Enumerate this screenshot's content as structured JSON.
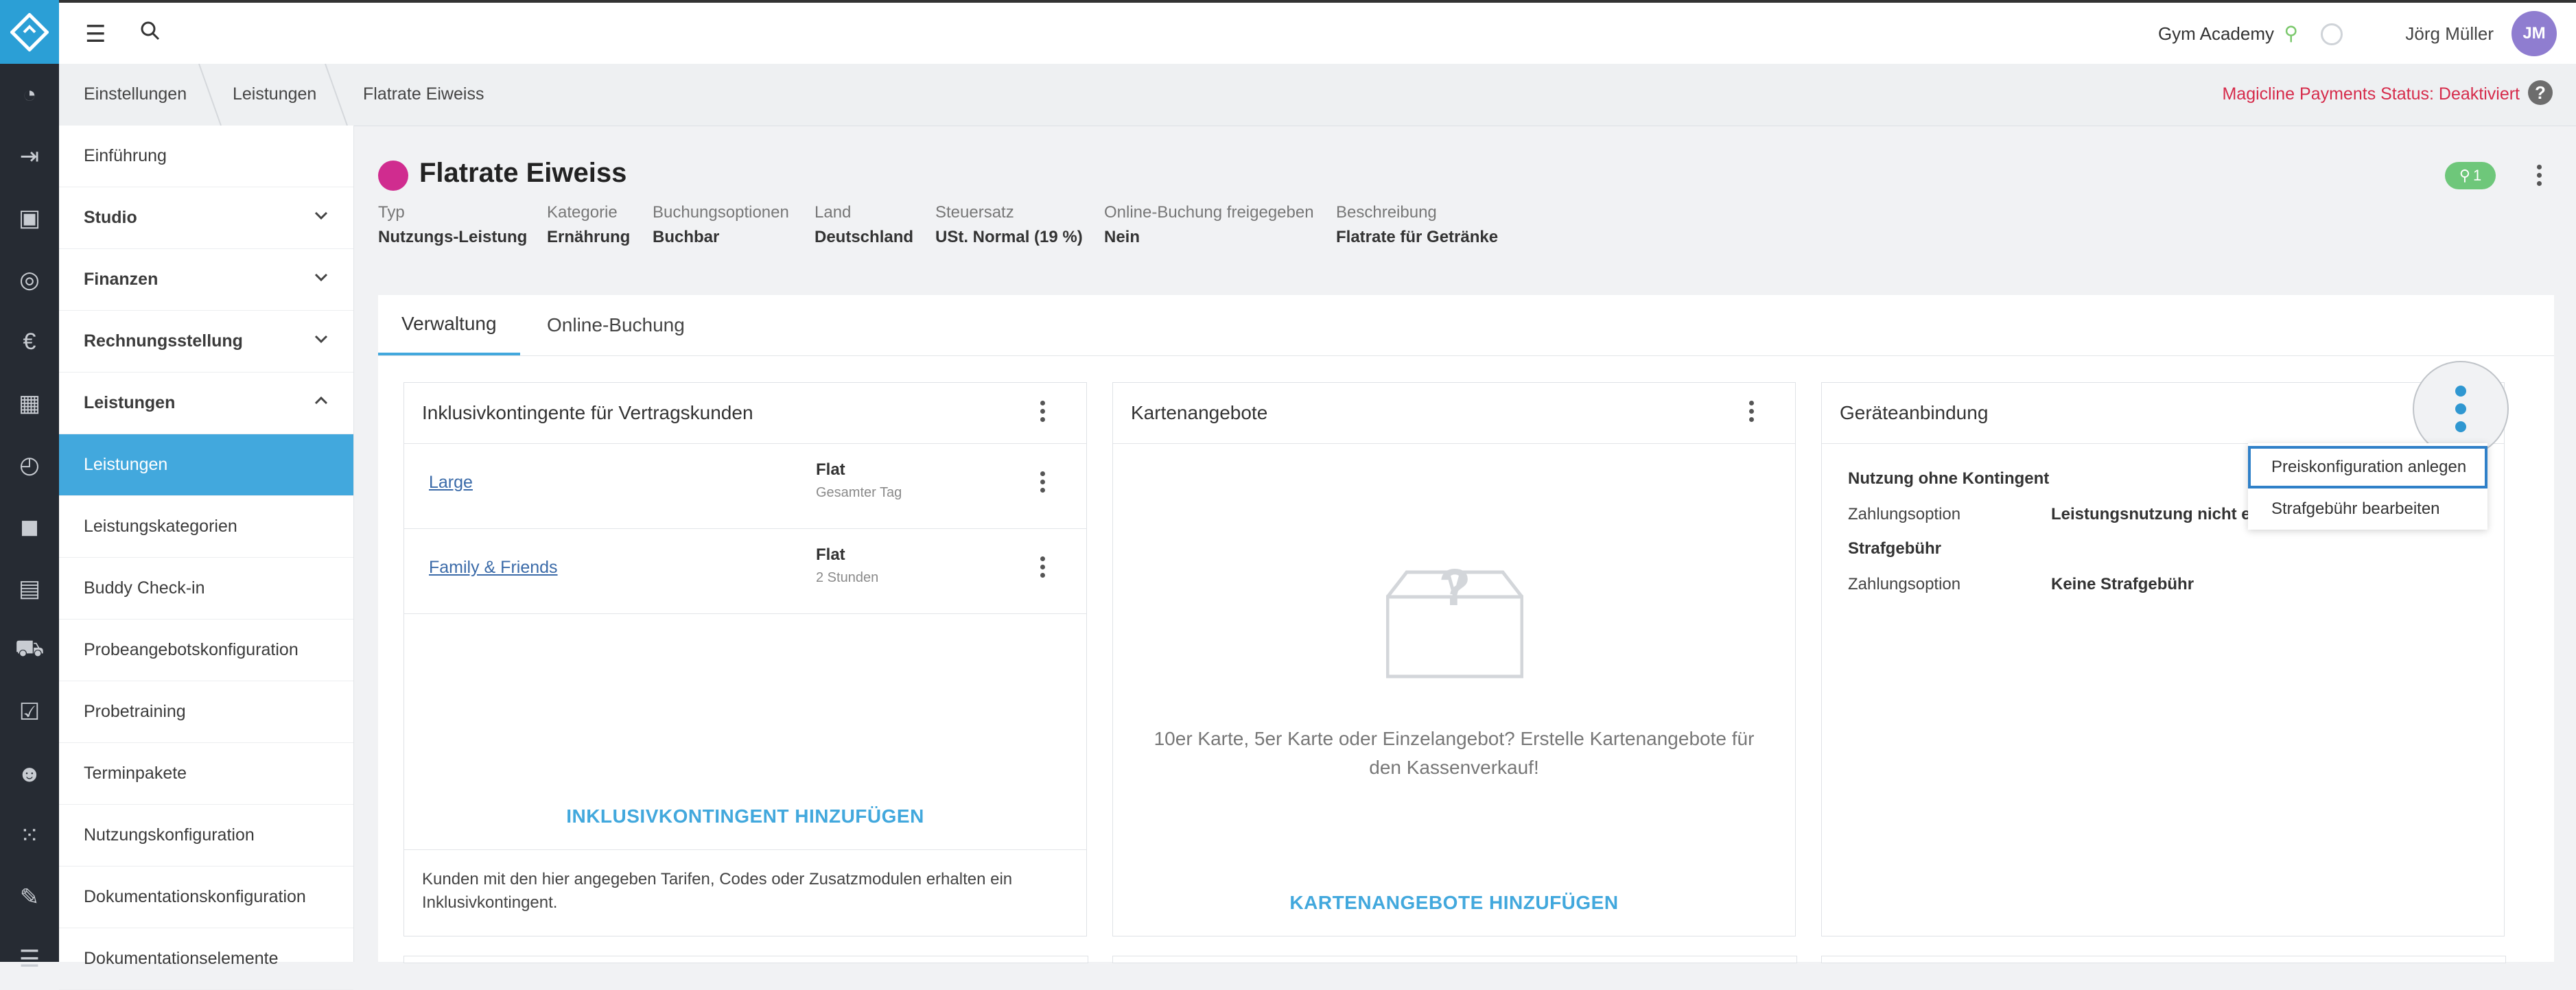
{
  "topbar": {
    "studio": "Gym Academy",
    "user_name": "Jörg Müller",
    "avatar_initials": "JM"
  },
  "breadcrumb": [
    "Einstellungen",
    "Leistungen",
    "Flatrate Eiweiss"
  ],
  "payments_status": "Magicline Payments Status: Deaktiviert",
  "help_label": "?",
  "sidebar": {
    "items": [
      {
        "label": "Einführung"
      },
      {
        "label": "Studio"
      },
      {
        "label": "Finanzen"
      },
      {
        "label": "Rechnungsstellung"
      },
      {
        "label": "Leistungen"
      },
      {
        "label": "Leistungen"
      },
      {
        "label": "Leistungskategorien"
      },
      {
        "label": "Buddy Check-in"
      },
      {
        "label": "Probeangebotskonfiguration"
      },
      {
        "label": "Probetraining"
      },
      {
        "label": "Terminpakete"
      },
      {
        "label": "Nutzungskonfiguration"
      },
      {
        "label": "Dokumentationskonfiguration"
      },
      {
        "label": "Dokumentationselemente"
      }
    ]
  },
  "service": {
    "title": "Flatrate Eiweiss",
    "color": "#d02c8f",
    "badge": "1",
    "meta": [
      {
        "key": "Typ",
        "value": "Nutzungs-Leistung"
      },
      {
        "key": "Kategorie",
        "value": "Ernährung"
      },
      {
        "key": "Buchungsoptionen",
        "value": "Buchbar"
      },
      {
        "key": "Land",
        "value": "Deutschland"
      },
      {
        "key": "Steuersatz",
        "value": "USt. Normal (19 %)"
      },
      {
        "key": "Online-Buchung freigegeben",
        "value": "Nein"
      },
      {
        "key": "Beschreibung",
        "value": "Flatrate für Getränke"
      }
    ]
  },
  "tabs": [
    "Verwaltung",
    "Online-Buchung"
  ],
  "cards": {
    "inklusiv": {
      "title": "Inklusivkontingente für Vertragskunden",
      "rows": [
        {
          "name": "Large",
          "type": "Flat",
          "sub": "Gesamter Tag"
        },
        {
          "name": "Family & Friends",
          "type": "Flat",
          "sub": "2 Stunden"
        }
      ],
      "add_label": "INKLUSIVKONTINGENT HINZUFÜGEN",
      "footer": "Kunden mit den hier angegeben Tarifen, Codes oder Zusatzmodulen erhalten ein Inklusivkontingent."
    },
    "karten": {
      "title": "Kartenangebote",
      "empty_text": "10er Karte, 5er Karte oder Einzelangebot? Erstelle Kartenangebote für den Kassenverkauf!",
      "add_label": "KARTENANGEBOTE HINZUFÜGEN"
    },
    "geraete": {
      "title": "Geräteanbindung",
      "section1": "Nutzung ohne Kontingent",
      "label1": "Zahlungsoption",
      "value1": "Leistungsnutzung nicht erla",
      "section2": "Strafgebühr",
      "label2": "Zahlungsoption",
      "value2": "Keine Strafgebühr"
    }
  },
  "menu": {
    "items": [
      "Preiskonfiguration anlegen",
      "Strafgebühr bearbeiten"
    ]
  },
  "colors": {
    "accent": "#42a8dd",
    "rail": "#262b33",
    "status_red": "#d62b4b",
    "badge_green": "#6ec77a"
  }
}
